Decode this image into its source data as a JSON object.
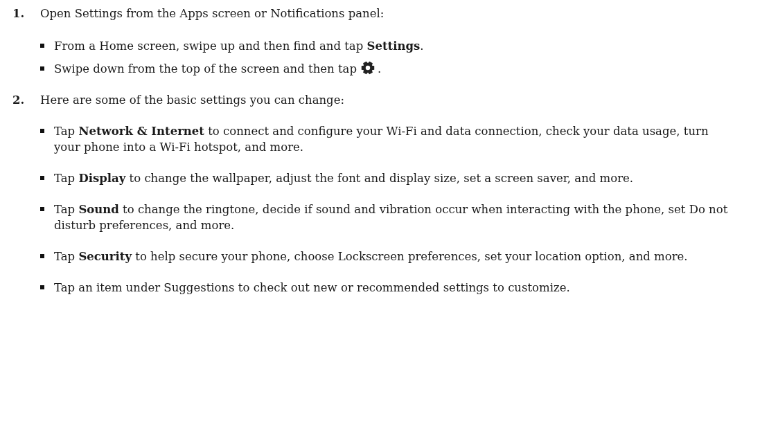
{
  "steps": [
    {
      "number": "1.",
      "text": "Open Settings from the Apps screen or Notifications panel:",
      "bullets": [
        {
          "kind": "text",
          "text": "From a Home screen, swipe up and then find and tap **Settings**."
        },
        {
          "kind": "icon",
          "text": "Swipe down from the top of the screen and then tap",
          "after": "."
        }
      ]
    },
    {
      "number": "2.",
      "text": "Here are some of the basic settings you can change:",
      "bullets": [
        {
          "kind": "text",
          "text": "Tap **Network & Internet** to connect and configure your Wi-Fi and data connection, check your data usage, turn your phone into a Wi-Fi hotspot, and more."
        },
        {
          "kind": "text",
          "text": "Tap **Display** to change the wallpaper, adjust the font and display size, set a screen saver, and more."
        },
        {
          "kind": "text",
          "text": "Tap **Sound** to change the ringtone, decide if sound and vibration occur when interacting with the phone, set Do not disturb preferences, and more."
        },
        {
          "kind": "text",
          "text": "Tap **Security** to help secure your phone, choose Lockscreen preferences, set your location option, and more."
        },
        {
          "kind": "text",
          "text": "Tap an item under Suggestions to check out new or recommended settings to customize."
        }
      ]
    }
  ]
}
